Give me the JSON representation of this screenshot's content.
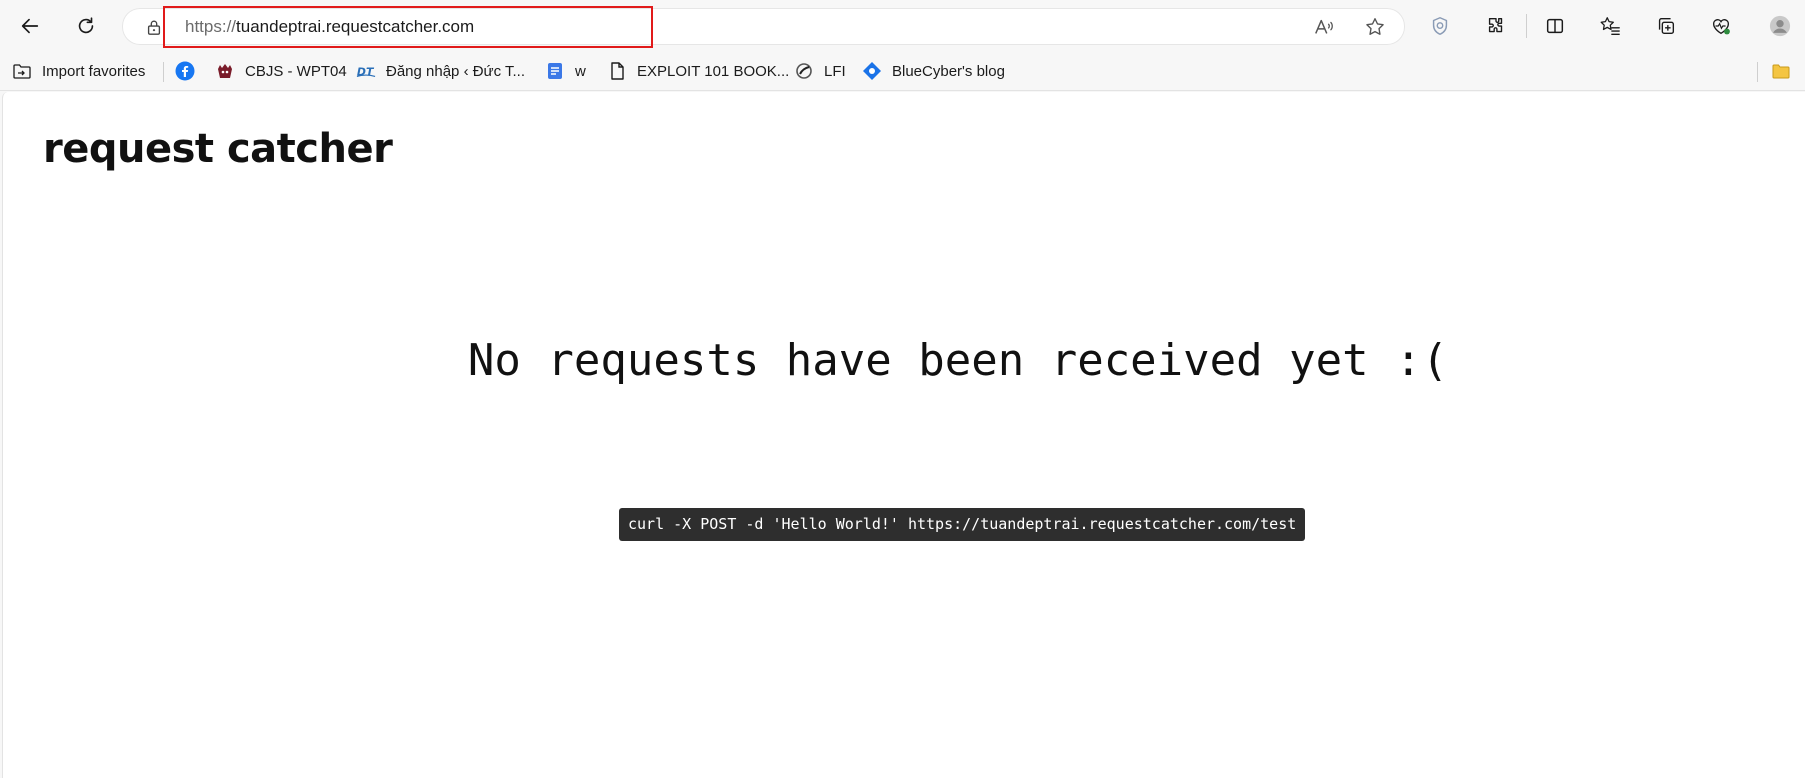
{
  "browser": {
    "address_bar": {
      "url_scheme": "https://",
      "url_host": "tuandeptrai.requestcatcher.com"
    },
    "toolbar_icons": [
      "back-icon",
      "refresh-icon",
      "lock-icon",
      "read-aloud-icon",
      "favorite-star-icon",
      "tracking-shield-icon",
      "extensions-icon",
      "split-screen-icon",
      "favorites-icon",
      "collections-icon",
      "browser-essentials-icon",
      "profile-avatar-icon"
    ],
    "favorites": [
      {
        "label": "Import favorites",
        "icon": "import-folder-icon"
      },
      {
        "label": "",
        "icon": "facebook-icon"
      },
      {
        "label": "CBJS - WPT04",
        "icon": "cbjs-logo-icon"
      },
      {
        "label": "Đăng nhập ‹ Đức T...",
        "icon": "dt-logo-icon"
      },
      {
        "label": "w",
        "icon": "docs-icon"
      },
      {
        "label": "EXPLOIT 101 BOOK...",
        "icon": "page-icon"
      },
      {
        "label": "LFI",
        "icon": "lfi-logo-icon"
      },
      {
        "label": "BlueCyber's blog",
        "icon": "bluecyber-icon"
      },
      {
        "label": "",
        "icon": "folder-icon"
      }
    ]
  },
  "page": {
    "title": "request catcher",
    "empty_message": "No requests have been received yet :(",
    "curl_example": "curl -X POST -d 'Hello World!' https://tuandeptrai.requestcatcher.com/test"
  },
  "colors": {
    "highlight_box": "#e11a1a",
    "code_background": "#2e2e2e",
    "facebook_blue": "#1877f2",
    "bluecyber_blue": "#1a73e8"
  }
}
